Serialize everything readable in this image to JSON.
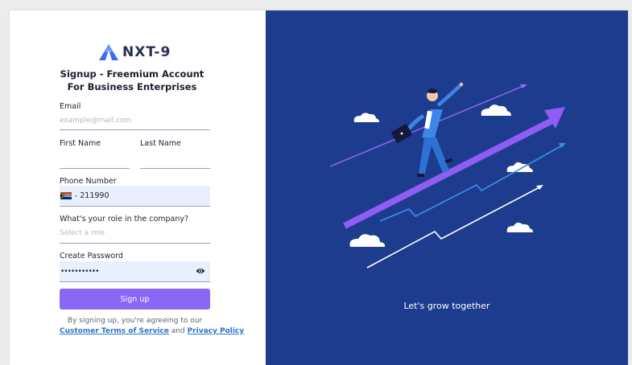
{
  "brand": {
    "name": "NXT-9"
  },
  "form": {
    "title": "Signup - Freemium Account For Business Enterprises",
    "email_label": "Email",
    "email_placeholder": "example@mail.com",
    "first_name_label": "First Name",
    "last_name_label": "Last Name",
    "phone_label": "Phone Number",
    "phone_dash": "-",
    "phone_value": "211990",
    "role_label": "What's your role in the company?",
    "role_placeholder": "Select a role",
    "password_label": "Create Password",
    "password_value": "•••••••••••",
    "signup_label": "Sign up",
    "terms_line1": "By signing up, you're agreeing to our",
    "terms_link1": "Customer Terms of Service",
    "terms_and": " and ",
    "terms_link2": "Privacy Policy"
  },
  "hero": {
    "tagline": "Let's grow together"
  },
  "icons": {
    "logo": "nxt-logo-icon",
    "flag": "south-africa-flag-icon",
    "eye": "eye-icon"
  },
  "colors": {
    "accent": "#8b67f5",
    "panel": "#1e3c8e",
    "link": "#2f73c9",
    "input_fill": "#e8f0fe"
  }
}
